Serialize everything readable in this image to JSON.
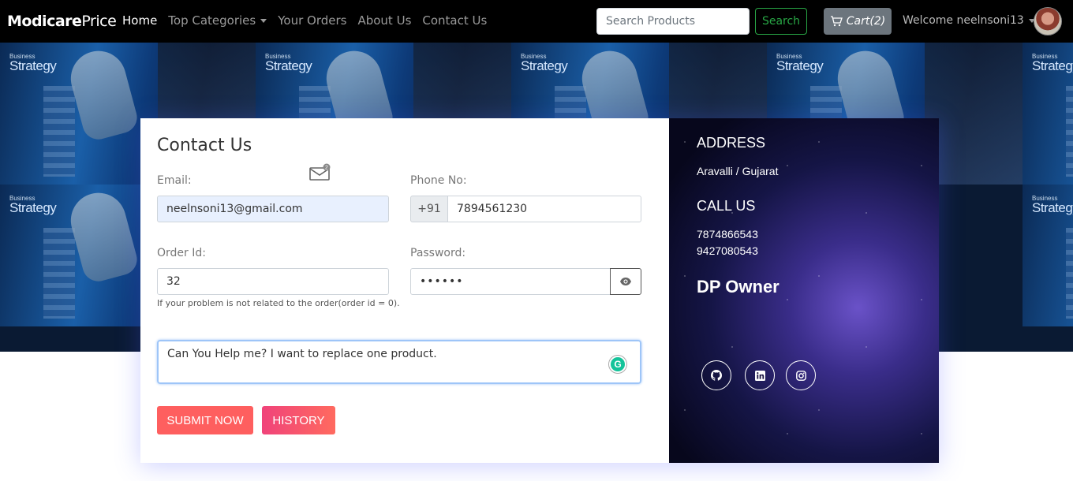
{
  "navbar": {
    "brand_bold": "Modicare",
    "brand_regular": "Price",
    "links": [
      "Home",
      "Top Categories",
      "Your Orders",
      "About Us",
      "Contact Us"
    ],
    "search_placeholder": "Search Products",
    "search_label": "Search",
    "cart_label": "Cart(2)",
    "welcome": "Welcome neelnsoni13"
  },
  "hero": {
    "tile_small": "Business",
    "tile_label": "Strategy"
  },
  "form": {
    "title": "Contact Us",
    "mail_badge": "2",
    "email_label": "Email:",
    "email_value": "neelnsoni13@gmail.com",
    "phone_label": "Phone No:",
    "phone_prefix": "+91",
    "phone_value": "7894561230",
    "order_label": "Order Id:",
    "order_value": "32",
    "password_label": "Password:",
    "password_value": "••••••",
    "hint": "If your problem is not related to the order(order id = 0).",
    "message": "Can You Help me? I want to replace one product.",
    "submit_label": "SUBMIT NOW",
    "history_label": "HISTORY"
  },
  "info": {
    "address_heading": "ADDRESS",
    "address": "Aravalli / Gujarat",
    "call_heading": "CALL US",
    "phone1": "7874866543",
    "phone2": "9427080543",
    "owner": "DP Owner",
    "social_icons": [
      "github-icon",
      "linkedin-icon",
      "instagram-icon"
    ]
  },
  "colors": {
    "navbar_bg": "#000000",
    "search_green": "#28a745",
    "cart_gray": "#6c757d",
    "submit": "#fe5f5f",
    "history": "#f0437a"
  }
}
